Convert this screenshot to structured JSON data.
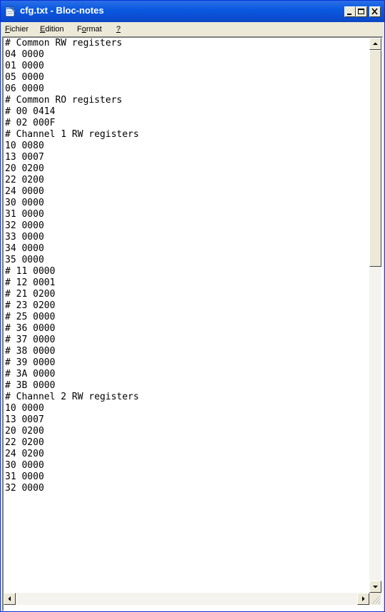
{
  "window": {
    "title": "cfg.txt - Bloc-notes",
    "buttons": {
      "minimize": "minimize-icon",
      "maximize": "maximize-icon",
      "close": "close-icon"
    }
  },
  "menu": {
    "items": [
      {
        "label": "Fichier",
        "accel": "F",
        "rest": "ichier"
      },
      {
        "label": "Edition",
        "accel": "E",
        "rest": "dition"
      },
      {
        "label": "Format",
        "accel_prefix": "F",
        "accel": "o",
        "rest": "rmat"
      },
      {
        "label": "?",
        "accel": "?",
        "rest": ""
      }
    ]
  },
  "document": {
    "lines": [
      "# Common RW registers",
      "04 0000",
      "01 0000",
      "05 0000",
      "06 0000",
      "# Common RO registers",
      "# 00 0414",
      "# 02 000F",
      "# Channel 1 RW registers",
      "10 0080",
      "13 0007",
      "20 0200",
      "22 0200",
      "24 0000",
      "30 0000",
      "31 0000",
      "32 0000",
      "33 0000",
      "34 0000",
      "35 0000",
      "# 11 0000",
      "# 12 0001",
      "# 21 0200",
      "# 23 0200",
      "# 25 0000",
      "# 36 0000",
      "# 37 0000",
      "# 38 0000",
      "# 39 0000",
      "# 3A 0000",
      "# 3B 0000",
      "# Channel 2 RW registers",
      "10 0000",
      "13 0007",
      "20 0200",
      "22 0200",
      "24 0200",
      "30 0000",
      "31 0000",
      "32 0000"
    ]
  },
  "icons": {
    "app": "notepad-icon",
    "scroll_up": "arrow-up-icon",
    "scroll_down": "arrow-down-icon",
    "scroll_left": "arrow-left-icon",
    "scroll_right": "arrow-right-icon"
  },
  "colors": {
    "titlebar": "#0a5ae0",
    "chrome": "#ece9d8"
  }
}
